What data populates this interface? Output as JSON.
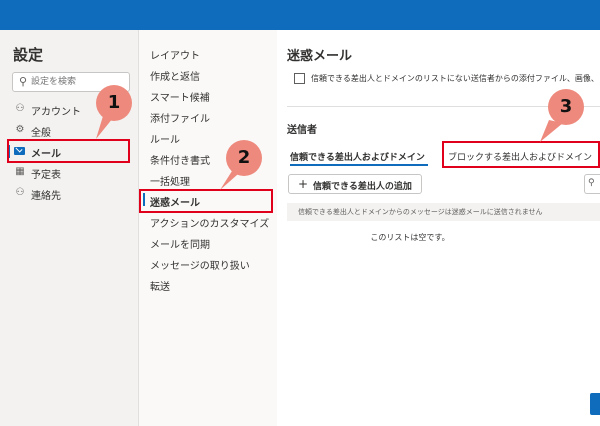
{
  "settings": {
    "title": "設定",
    "search_placeholder": "設定を検索",
    "nav": [
      {
        "label": "アカウント",
        "icon": "person-icon"
      },
      {
        "label": "全般",
        "icon": "gear-icon"
      },
      {
        "label": "メール",
        "icon": "mail-icon",
        "selected": true
      },
      {
        "label": "予定表",
        "icon": "calendar-icon"
      },
      {
        "label": "連絡先",
        "icon": "people-icon"
      }
    ]
  },
  "mail_nav": [
    {
      "label": "レイアウト"
    },
    {
      "label": "作成と返信"
    },
    {
      "label": "スマート候補"
    },
    {
      "label": "添付ファイル"
    },
    {
      "label": "ルール"
    },
    {
      "label": "条件付き書式"
    },
    {
      "label": "一括処理"
    },
    {
      "label": "迷惑メール",
      "selected": true
    },
    {
      "label": "アクションのカスタマイズ"
    },
    {
      "label": "メールを同期"
    },
    {
      "label": "メッセージの取り扱い"
    },
    {
      "label": "転送"
    }
  ],
  "junk": {
    "title": "迷惑メール",
    "checkbox_label": "信頼できる差出人とドメインのリストにない送信者からの添付ファイル、画像、リン",
    "senders_heading": "送信者",
    "tab_trusted": "信頼できる差出人およびドメイン",
    "tab_blocked": "ブロックする差出人およびドメイン",
    "add_button": "信頼できる差出人の追加",
    "notice": "信頼できる差出人とドメインからのメッセージは迷惑メールに送信されません",
    "empty_text": "このリストは空です。"
  },
  "callouts": {
    "one": "1",
    "two": "2",
    "three": "3",
    "color": "#e0001b",
    "badge_color": "#ee8a7d"
  },
  "colors": {
    "accent": "#0f6cbd",
    "topbar": "#0f6cbd"
  }
}
